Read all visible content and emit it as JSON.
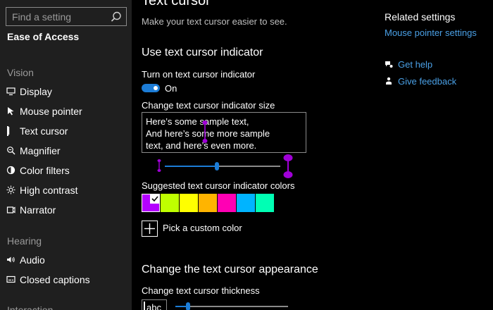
{
  "sidebar": {
    "search_placeholder": "Find a setting",
    "section_title": "Ease of Access",
    "groups": {
      "vision": "Vision",
      "hearing": "Hearing",
      "interaction": "Interaction"
    },
    "items": {
      "display": "Display",
      "mouse_pointer": "Mouse pointer",
      "text_cursor": "Text cursor",
      "magnifier": "Magnifier",
      "color_filters": "Color filters",
      "high_contrast": "High contrast",
      "narrator": "Narrator",
      "audio": "Audio",
      "closed_captions": "Closed captions"
    }
  },
  "main": {
    "page_title": "Text cursor",
    "description": "Make your text cursor easier to see.",
    "indicator_heading": "Use text cursor indicator",
    "toggle_label": "Turn on text cursor indicator",
    "toggle_state": "On",
    "size_label": "Change text cursor indicator size",
    "sample_lines": [
      "Here’s some sample text,",
      "And here’s some more sample",
      "text, and here’s even more."
    ],
    "size_slider_value": 0.45,
    "colors_label": "Suggested text cursor indicator colors",
    "colors": [
      "#b400ff",
      "#bfff00",
      "#ffff00",
      "#ffb400",
      "#ff00b4",
      "#00b4ff",
      "#00ffb4"
    ],
    "selected_color_index": 0,
    "custom_color_label": "Pick a custom color",
    "appearance_heading": "Change the text cursor appearance",
    "thickness_label": "Change text cursor thickness",
    "thickness_sample": "abc",
    "thickness_slider_value": 0.1
  },
  "related": {
    "heading": "Related settings",
    "mouse_pointer_link": "Mouse pointer settings",
    "get_help": "Get help",
    "give_feedback": "Give feedback"
  },
  "colors": {
    "accent": "#1c7cd6",
    "link": "#4aa0e6",
    "indicator": "#a000d8",
    "sidebar_bg": "#1f1f1f"
  }
}
